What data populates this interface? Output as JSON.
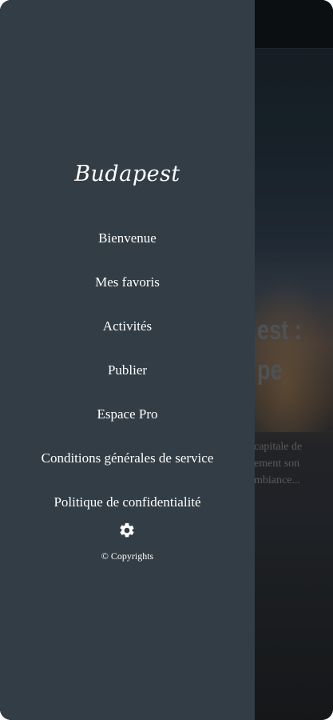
{
  "background": {
    "title_lines": "est :\npe",
    "description_lines": "capitale de\nement son\nmbiance..."
  },
  "drawer": {
    "brand": "Budapest",
    "items": [
      {
        "label": "Bienvenue"
      },
      {
        "label": "Mes favoris"
      },
      {
        "label": "Activités"
      },
      {
        "label": "Publier"
      },
      {
        "label": "Espace Pro"
      },
      {
        "label": "Conditions générales de service"
      },
      {
        "label": "Politique de confidentialité"
      }
    ],
    "settings_icon": "gear-icon",
    "copyright": "© Copyrights"
  },
  "colors": {
    "drawer_bg": "#323d45",
    "text": "#ffffff"
  }
}
